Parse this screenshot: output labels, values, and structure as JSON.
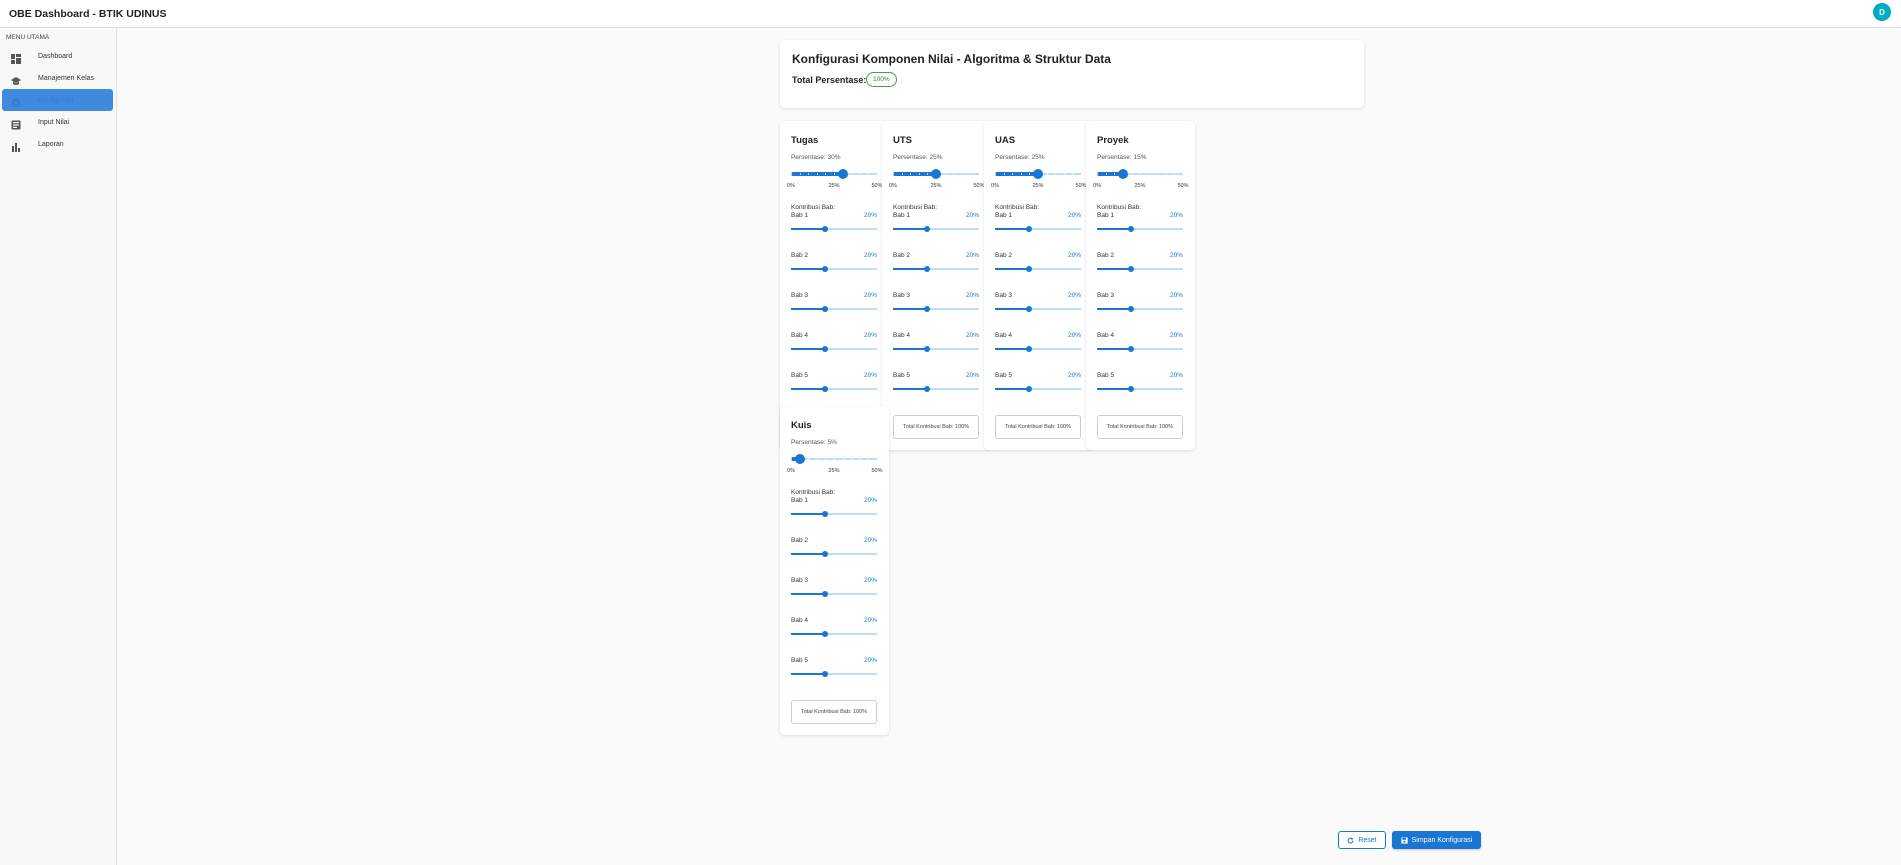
{
  "app": {
    "title": "OBE Dashboard - BTIK UDINUS",
    "avatar_initial": "D"
  },
  "sidebar": {
    "header": "MENU UTAMA",
    "items": [
      {
        "label": "Dashboard",
        "icon": "dashboard-icon"
      },
      {
        "label": "Manajemen Kelas",
        "icon": "school-icon"
      },
      {
        "label": "Konfigurasi",
        "icon": "gear-icon",
        "active": true
      },
      {
        "label": "Input Nilai",
        "icon": "grade-icon"
      },
      {
        "label": "Laporan",
        "icon": "bar-chart-icon"
      }
    ]
  },
  "header": {
    "title": "Konfigurasi Komponen Nilai - Algoritma & Struktur Data",
    "total_label": "Total Persentase:",
    "total_value": "100%"
  },
  "kontribusi_label": "Kontribusi Bab:",
  "scale_marks": [
    "0%",
    "25%",
    "50%"
  ],
  "components": [
    {
      "name": "Tugas",
      "percent_text": "Persentase: 30%",
      "percent": 30,
      "babs": [
        {
          "name": "Bab 1",
          "value": "20%",
          "level": 20
        },
        {
          "name": "Bab 2",
          "value": "20%",
          "level": 20
        },
        {
          "name": "Bab 3",
          "value": "20%",
          "level": 20
        },
        {
          "name": "Bab 4",
          "value": "20%",
          "level": 20
        },
        {
          "name": "Bab 5",
          "value": "20%",
          "level": 20
        }
      ],
      "total_text": "Total Kontribusi Bab: 100%"
    },
    {
      "name": "UTS",
      "percent_text": "Persentase: 25%",
      "percent": 25,
      "babs": [
        {
          "name": "Bab 1",
          "value": "20%",
          "level": 20
        },
        {
          "name": "Bab 2",
          "value": "20%",
          "level": 20
        },
        {
          "name": "Bab 3",
          "value": "20%",
          "level": 20
        },
        {
          "name": "Bab 4",
          "value": "20%",
          "level": 20
        },
        {
          "name": "Bab 5",
          "value": "20%",
          "level": 20
        }
      ],
      "total_text": "Total Kontribusi Bab: 100%"
    },
    {
      "name": "UAS",
      "percent_text": "Persentase: 25%",
      "percent": 25,
      "babs": [
        {
          "name": "Bab 1",
          "value": "20%",
          "level": 20
        },
        {
          "name": "Bab 2",
          "value": "20%",
          "level": 20
        },
        {
          "name": "Bab 3",
          "value": "20%",
          "level": 20
        },
        {
          "name": "Bab 4",
          "value": "20%",
          "level": 20
        },
        {
          "name": "Bab 5",
          "value": "20%",
          "level": 20
        }
      ],
      "total_text": "Total Kontribusi Bab: 100%"
    },
    {
      "name": "Proyek",
      "percent_text": "Persentase: 15%",
      "percent": 15,
      "babs": [
        {
          "name": "Bab 1",
          "value": "20%",
          "level": 20
        },
        {
          "name": "Bab 2",
          "value": "20%",
          "level": 20
        },
        {
          "name": "Bab 3",
          "value": "20%",
          "level": 20
        },
        {
          "name": "Bab 4",
          "value": "20%",
          "level": 20
        },
        {
          "name": "Bab 5",
          "value": "20%",
          "level": 20
        }
      ],
      "total_text": "Total Kontribusi Bab: 100%"
    },
    {
      "name": "Kuis",
      "percent_text": "Persentase: 5%",
      "percent": 5,
      "babs": [
        {
          "name": "Bab 1",
          "value": "20%",
          "level": 20
        },
        {
          "name": "Bab 2",
          "value": "20%",
          "level": 20
        },
        {
          "name": "Bab 3",
          "value": "20%",
          "level": 20
        },
        {
          "name": "Bab 4",
          "value": "20%",
          "level": 20
        },
        {
          "name": "Bab 5",
          "value": "20%",
          "level": 20
        }
      ],
      "total_text": "Total Kontribusi Bab: 100%"
    }
  ],
  "actions": {
    "reset_label": "Reset",
    "save_label": "Simpan Konfigurasi"
  },
  "colors": {
    "primary": "#1976d2",
    "active_nav": "#3f8ade",
    "badge": "#43a047",
    "avatar": "#00acc1"
  }
}
